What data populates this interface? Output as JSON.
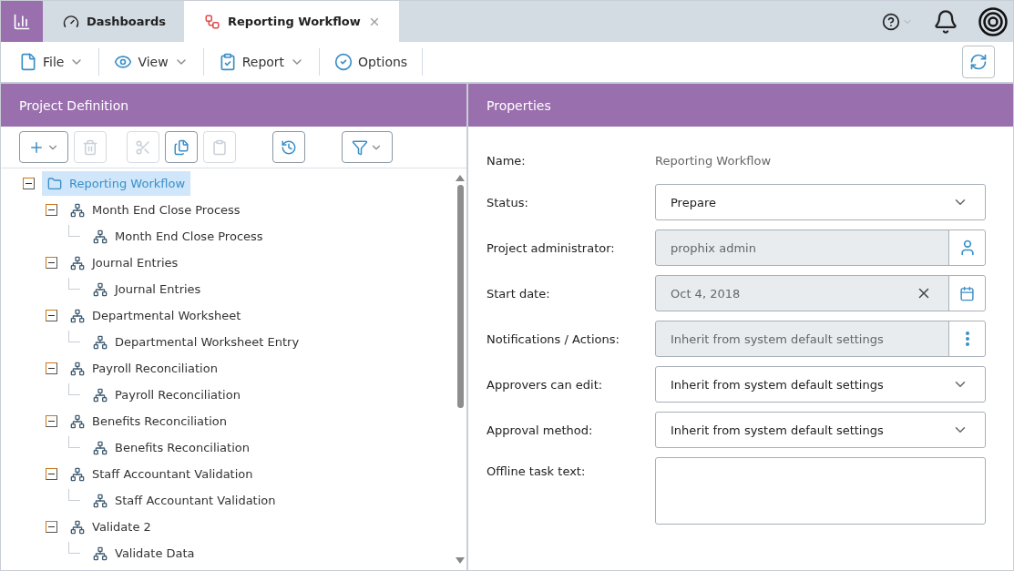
{
  "tabs": [
    {
      "kind": "dashboard",
      "label": "Dashboards",
      "selected": false,
      "closable": false
    },
    {
      "kind": "workflow",
      "label": "Reporting Workflow",
      "selected": true,
      "closable": true
    }
  ],
  "menu": [
    {
      "kind": "file",
      "label": "File",
      "dropdown": true
    },
    {
      "kind": "view",
      "label": "View",
      "dropdown": true
    },
    {
      "kind": "report",
      "label": "Report",
      "dropdown": true
    },
    {
      "kind": "options",
      "label": "Options",
      "dropdown": false
    }
  ],
  "left_panel": {
    "title": "Project Definition",
    "toolbar": [
      {
        "kind": "add",
        "disabled": false
      },
      {
        "kind": "delete",
        "disabled": true
      },
      {
        "kind": "cut",
        "disabled": true
      },
      {
        "kind": "copy",
        "disabled": false
      },
      {
        "kind": "paste",
        "disabled": true
      },
      {
        "kind": "history",
        "disabled": false
      },
      {
        "kind": "filter",
        "disabled": false
      }
    ],
    "tree": [
      {
        "label": "Reporting Workflow",
        "kind": "folder",
        "selected": true,
        "expanded": true,
        "children": [
          {
            "label": "Month End Close Process",
            "kind": "process",
            "selected": false,
            "expanded": true,
            "children": [
              {
                "label": "Month End Close Process",
                "kind": "process",
                "selected": false
              }
            ]
          },
          {
            "label": "Journal Entries",
            "kind": "process",
            "selected": false,
            "expanded": true,
            "children": [
              {
                "label": "Journal Entries",
                "kind": "process",
                "selected": false
              }
            ]
          },
          {
            "label": "Departmental Worksheet",
            "kind": "process",
            "selected": false,
            "expanded": true,
            "children": [
              {
                "label": "Departmental Worksheet Entry",
                "kind": "process",
                "selected": false
              }
            ]
          },
          {
            "label": "Payroll Reconciliation",
            "kind": "process",
            "selected": false,
            "expanded": true,
            "children": [
              {
                "label": "Payroll Reconciliation",
                "kind": "process",
                "selected": false
              }
            ]
          },
          {
            "label": "Benefits Reconciliation",
            "kind": "process",
            "selected": false,
            "expanded": true,
            "children": [
              {
                "label": "Benefits Reconciliation",
                "kind": "process",
                "selected": false
              }
            ]
          },
          {
            "label": "Staff Accountant Validation",
            "kind": "process",
            "selected": false,
            "expanded": true,
            "children": [
              {
                "label": "Staff Accountant Validation",
                "kind": "process",
                "selected": false
              }
            ]
          },
          {
            "label": "Validate 2",
            "kind": "process",
            "selected": false,
            "expanded": true,
            "children": [
              {
                "label": "Validate Data",
                "kind": "process",
                "selected": false
              }
            ]
          }
        ]
      }
    ]
  },
  "properties": {
    "title": "Properties",
    "fields": [
      {
        "kind": "text",
        "label": "Name:",
        "value": "Reporting Workflow"
      },
      {
        "kind": "select",
        "label": "Status:",
        "value": "Prepare",
        "disabled": false
      },
      {
        "kind": "user",
        "label": "Project administrator:",
        "value": "prophix admin",
        "disabled": true
      },
      {
        "kind": "date",
        "label": "Start date:",
        "value": "Oct 4, 2018",
        "disabled": true
      },
      {
        "kind": "menu",
        "label": "Notifications / Actions:",
        "value": "Inherit from system default settings",
        "disabled": true
      },
      {
        "kind": "select",
        "label": "Approvers can edit:",
        "value": "Inherit from system default settings",
        "disabled": false
      },
      {
        "kind": "select",
        "label": "Approval method:",
        "value": "Inherit from system default settings",
        "disabled": false
      },
      {
        "kind": "textarea",
        "label": "Offline task text:",
        "disabled": false
      }
    ]
  }
}
